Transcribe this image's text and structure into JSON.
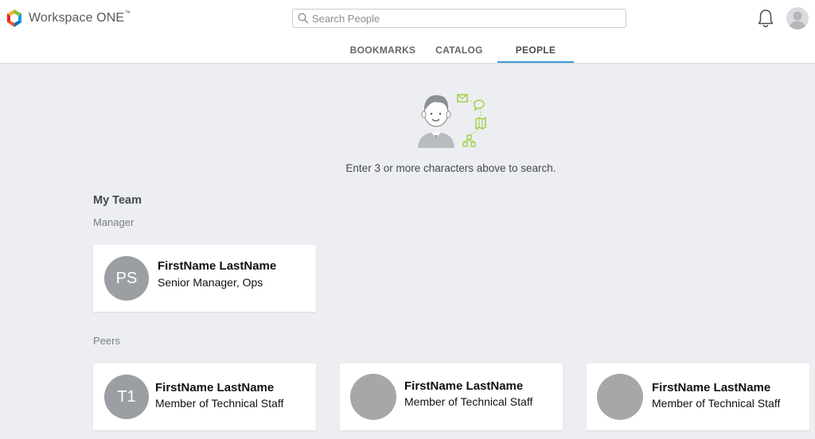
{
  "app": {
    "name": "Workspace ONE",
    "trademark": "™"
  },
  "search": {
    "placeholder": "Search People",
    "value": ""
  },
  "tabs": [
    {
      "label": "BOOKMARKS",
      "active": false
    },
    {
      "label": "CATALOG",
      "active": false
    },
    {
      "label": "PEOPLE",
      "active": true
    }
  ],
  "empty_state": {
    "message": "Enter 3 or more characters above to search."
  },
  "team": {
    "title": "My Team",
    "manager_label": "Manager",
    "manager": {
      "initials": "PS",
      "name": "FirstName LastName",
      "role": "Senior Manager, Ops"
    },
    "peers_label": "Peers",
    "peers": [
      {
        "initials": "T1",
        "name": "FirstName LastName",
        "role": "Member of Technical Staff"
      },
      {
        "initials": "",
        "name": "FirstName LastName",
        "role": "Member of Technical Staff"
      },
      {
        "initials": "",
        "name": "FirstName LastName",
        "role": "Member of Technical Staff"
      }
    ]
  },
  "colors": {
    "accent": "#3d9ad6",
    "background": "#eceef1",
    "avatar": "#9b9ea3",
    "illustration_green": "#9bcf3c"
  }
}
